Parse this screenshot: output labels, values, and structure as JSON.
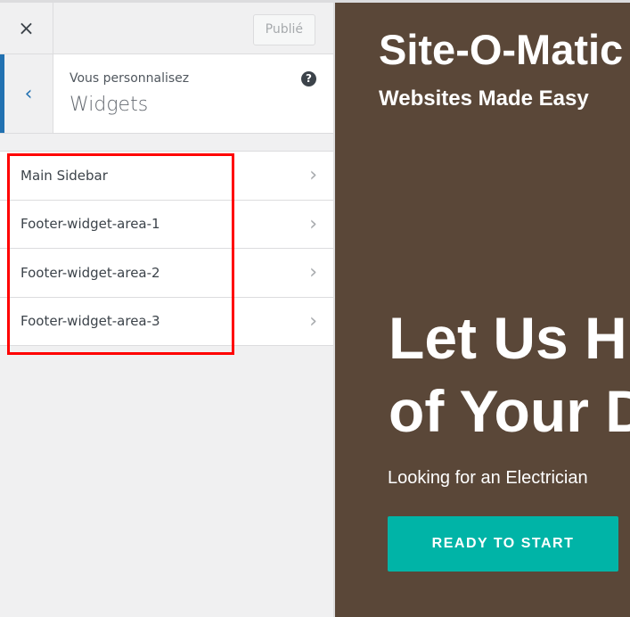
{
  "controls": {
    "publish_label": "Publié",
    "close_icon": "×",
    "back_icon": "‹"
  },
  "header": {
    "subtitle": "Vous personnalisez",
    "title": "Widgets",
    "help": "?"
  },
  "widget_areas": [
    {
      "label": "Main Sidebar"
    },
    {
      "label": "Footer-widget-area-1"
    },
    {
      "label": "Footer-widget-area-2"
    },
    {
      "label": "Footer-widget-area-3"
    }
  ],
  "preview": {
    "site_title": "Site-O-Matic",
    "tagline": "Websites Made Easy",
    "headline_1": "Let Us H",
    "headline_2": "of Your D",
    "lead": "Looking for an Electrician",
    "cta": "READY TO START"
  },
  "colors": {
    "accent": "#2271b1",
    "highlight": "#ff0000",
    "cta": "#00b4a7",
    "preview_bg": "#5a4738"
  }
}
